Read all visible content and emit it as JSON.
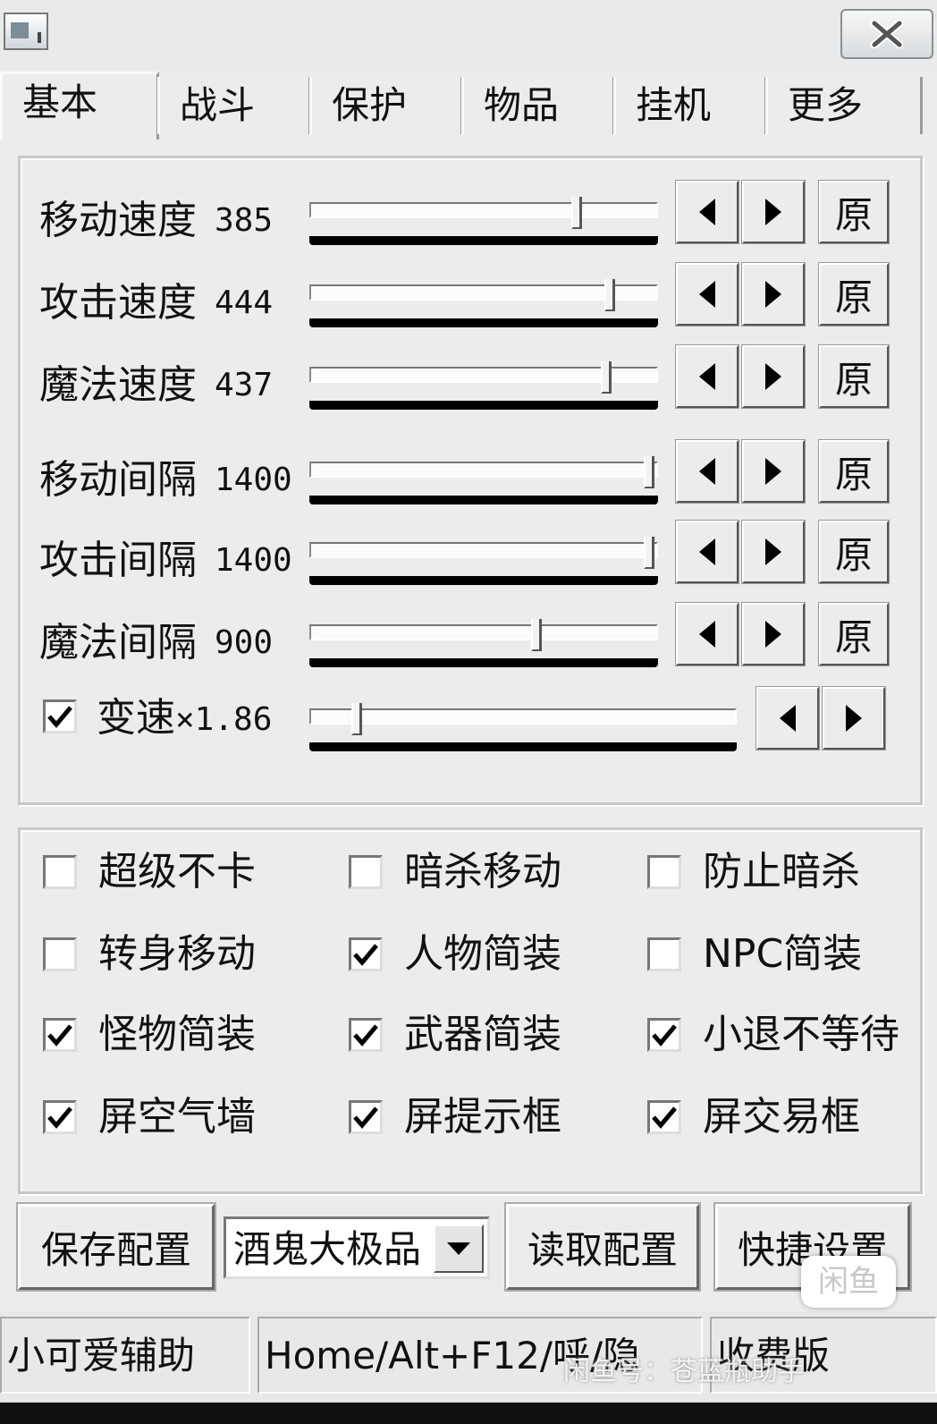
{
  "tabs": [
    "基本",
    "战斗",
    "保护",
    "物品",
    "挂机",
    "更多"
  ],
  "active_tab": 0,
  "sliders": [
    {
      "label": "移动速度",
      "value": "385",
      "position": 0.78
    },
    {
      "label": "攻击速度",
      "value": "444",
      "position": 0.88
    },
    {
      "label": "魔法速度",
      "value": "437",
      "position": 0.87
    },
    {
      "label": "移动间隔",
      "value": "1400",
      "position": 1.0
    },
    {
      "label": "攻击间隔",
      "value": "1400",
      "position": 1.0
    },
    {
      "label": "魔法间隔",
      "value": "900",
      "position": 0.66
    }
  ],
  "reset_label": "原",
  "speed_multiplier": {
    "checked": true,
    "label": "变速",
    "value": "×1.86",
    "position": 0.1
  },
  "options": [
    {
      "label": "超级不卡",
      "checked": false
    },
    {
      "label": "暗杀移动",
      "checked": false
    },
    {
      "label": "防止暗杀",
      "checked": false
    },
    {
      "label": "转身移动",
      "checked": false
    },
    {
      "label": "人物简装",
      "checked": true
    },
    {
      "label": "NPC简装",
      "checked": false
    },
    {
      "label": "怪物简装",
      "checked": true
    },
    {
      "label": "武器简装",
      "checked": true
    },
    {
      "label": "小退不等待",
      "checked": true
    },
    {
      "label": "屏空气墙",
      "checked": true
    },
    {
      "label": "屏提示框",
      "checked": true
    },
    {
      "label": "屏交易框",
      "checked": true
    }
  ],
  "bottom": {
    "save_label": "保存配置",
    "profile_value": "酒鬼大极品",
    "load_label": "读取配置",
    "shortcut_label": "快捷设置"
  },
  "status": {
    "app_name": "小可爱辅助",
    "hotkey": "Home/Alt+F12/呼/隐",
    "edition": "收费版"
  },
  "watermark": {
    "bubble": "闲鱼",
    "text": "闲鱼号：苍蓝瓶助手"
  }
}
